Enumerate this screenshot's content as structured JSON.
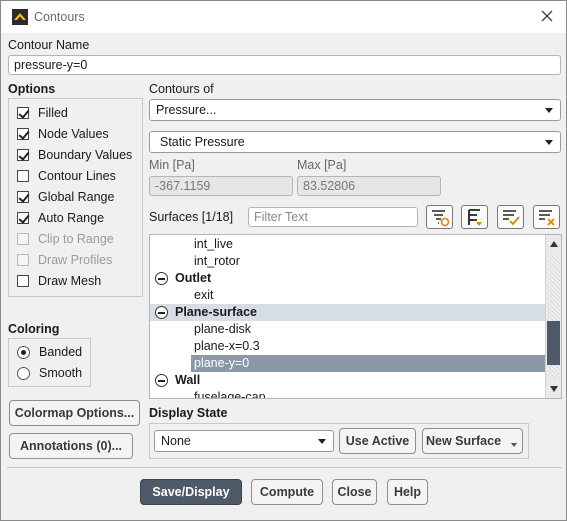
{
  "window": {
    "title": "Contours"
  },
  "contour_name": {
    "label": "Contour Name",
    "value": "pressure-y=0"
  },
  "options": {
    "label": "Options",
    "items": [
      {
        "label": "Filled",
        "checked": true,
        "disabled": false
      },
      {
        "label": "Node Values",
        "checked": true,
        "disabled": false
      },
      {
        "label": "Boundary Values",
        "checked": true,
        "disabled": false
      },
      {
        "label": "Contour Lines",
        "checked": false,
        "disabled": false
      },
      {
        "label": "Global Range",
        "checked": true,
        "disabled": false
      },
      {
        "label": "Auto Range",
        "checked": true,
        "disabled": false
      },
      {
        "label": "Clip to Range",
        "checked": false,
        "disabled": true
      },
      {
        "label": "Draw Profiles",
        "checked": false,
        "disabled": true
      },
      {
        "label": "Draw Mesh",
        "checked": false,
        "disabled": false
      }
    ]
  },
  "coloring": {
    "label": "Coloring",
    "options": [
      {
        "label": "Banded",
        "selected": true
      },
      {
        "label": "Smooth",
        "selected": false
      }
    ]
  },
  "left_buttons": {
    "colormap": "Colormap Options...",
    "annotations": "Annotations (0)..."
  },
  "contours_of": {
    "label": "Contours of",
    "category": "Pressure...",
    "variable": "Static Pressure"
  },
  "range": {
    "min_label": "Min [Pa]",
    "min_value": "-367.1159",
    "max_label": "Max [Pa]",
    "max_value": "83.52806"
  },
  "surfaces": {
    "label": "Surfaces [1/18]",
    "filter_placeholder": "Filter Text",
    "tree": [
      {
        "kind": "leaf",
        "text": "int_live"
      },
      {
        "kind": "leaf",
        "text": "int_rotor"
      },
      {
        "kind": "group",
        "text": "Outlet"
      },
      {
        "kind": "leaf",
        "text": "exit"
      },
      {
        "kind": "group",
        "text": "Plane-surface"
      },
      {
        "kind": "leaf",
        "text": "plane-disk"
      },
      {
        "kind": "leaf",
        "text": "plane-x=0.3"
      },
      {
        "kind": "leaf",
        "text": "plane-y=0",
        "selected": true
      },
      {
        "kind": "group",
        "text": "Wall"
      },
      {
        "kind": "leaf",
        "text": "fuselage-cap"
      }
    ]
  },
  "display_state": {
    "label": "Display State",
    "value": "None",
    "use_active": "Use Active",
    "new_surface": "New Surface"
  },
  "footer": {
    "save_display": "Save/Display",
    "compute": "Compute",
    "close": "Close",
    "help": "Help"
  },
  "colors": {
    "primary_button": "#4e5a67",
    "selected_row": "#8b98a8",
    "selected_group": "#d7dde5"
  }
}
